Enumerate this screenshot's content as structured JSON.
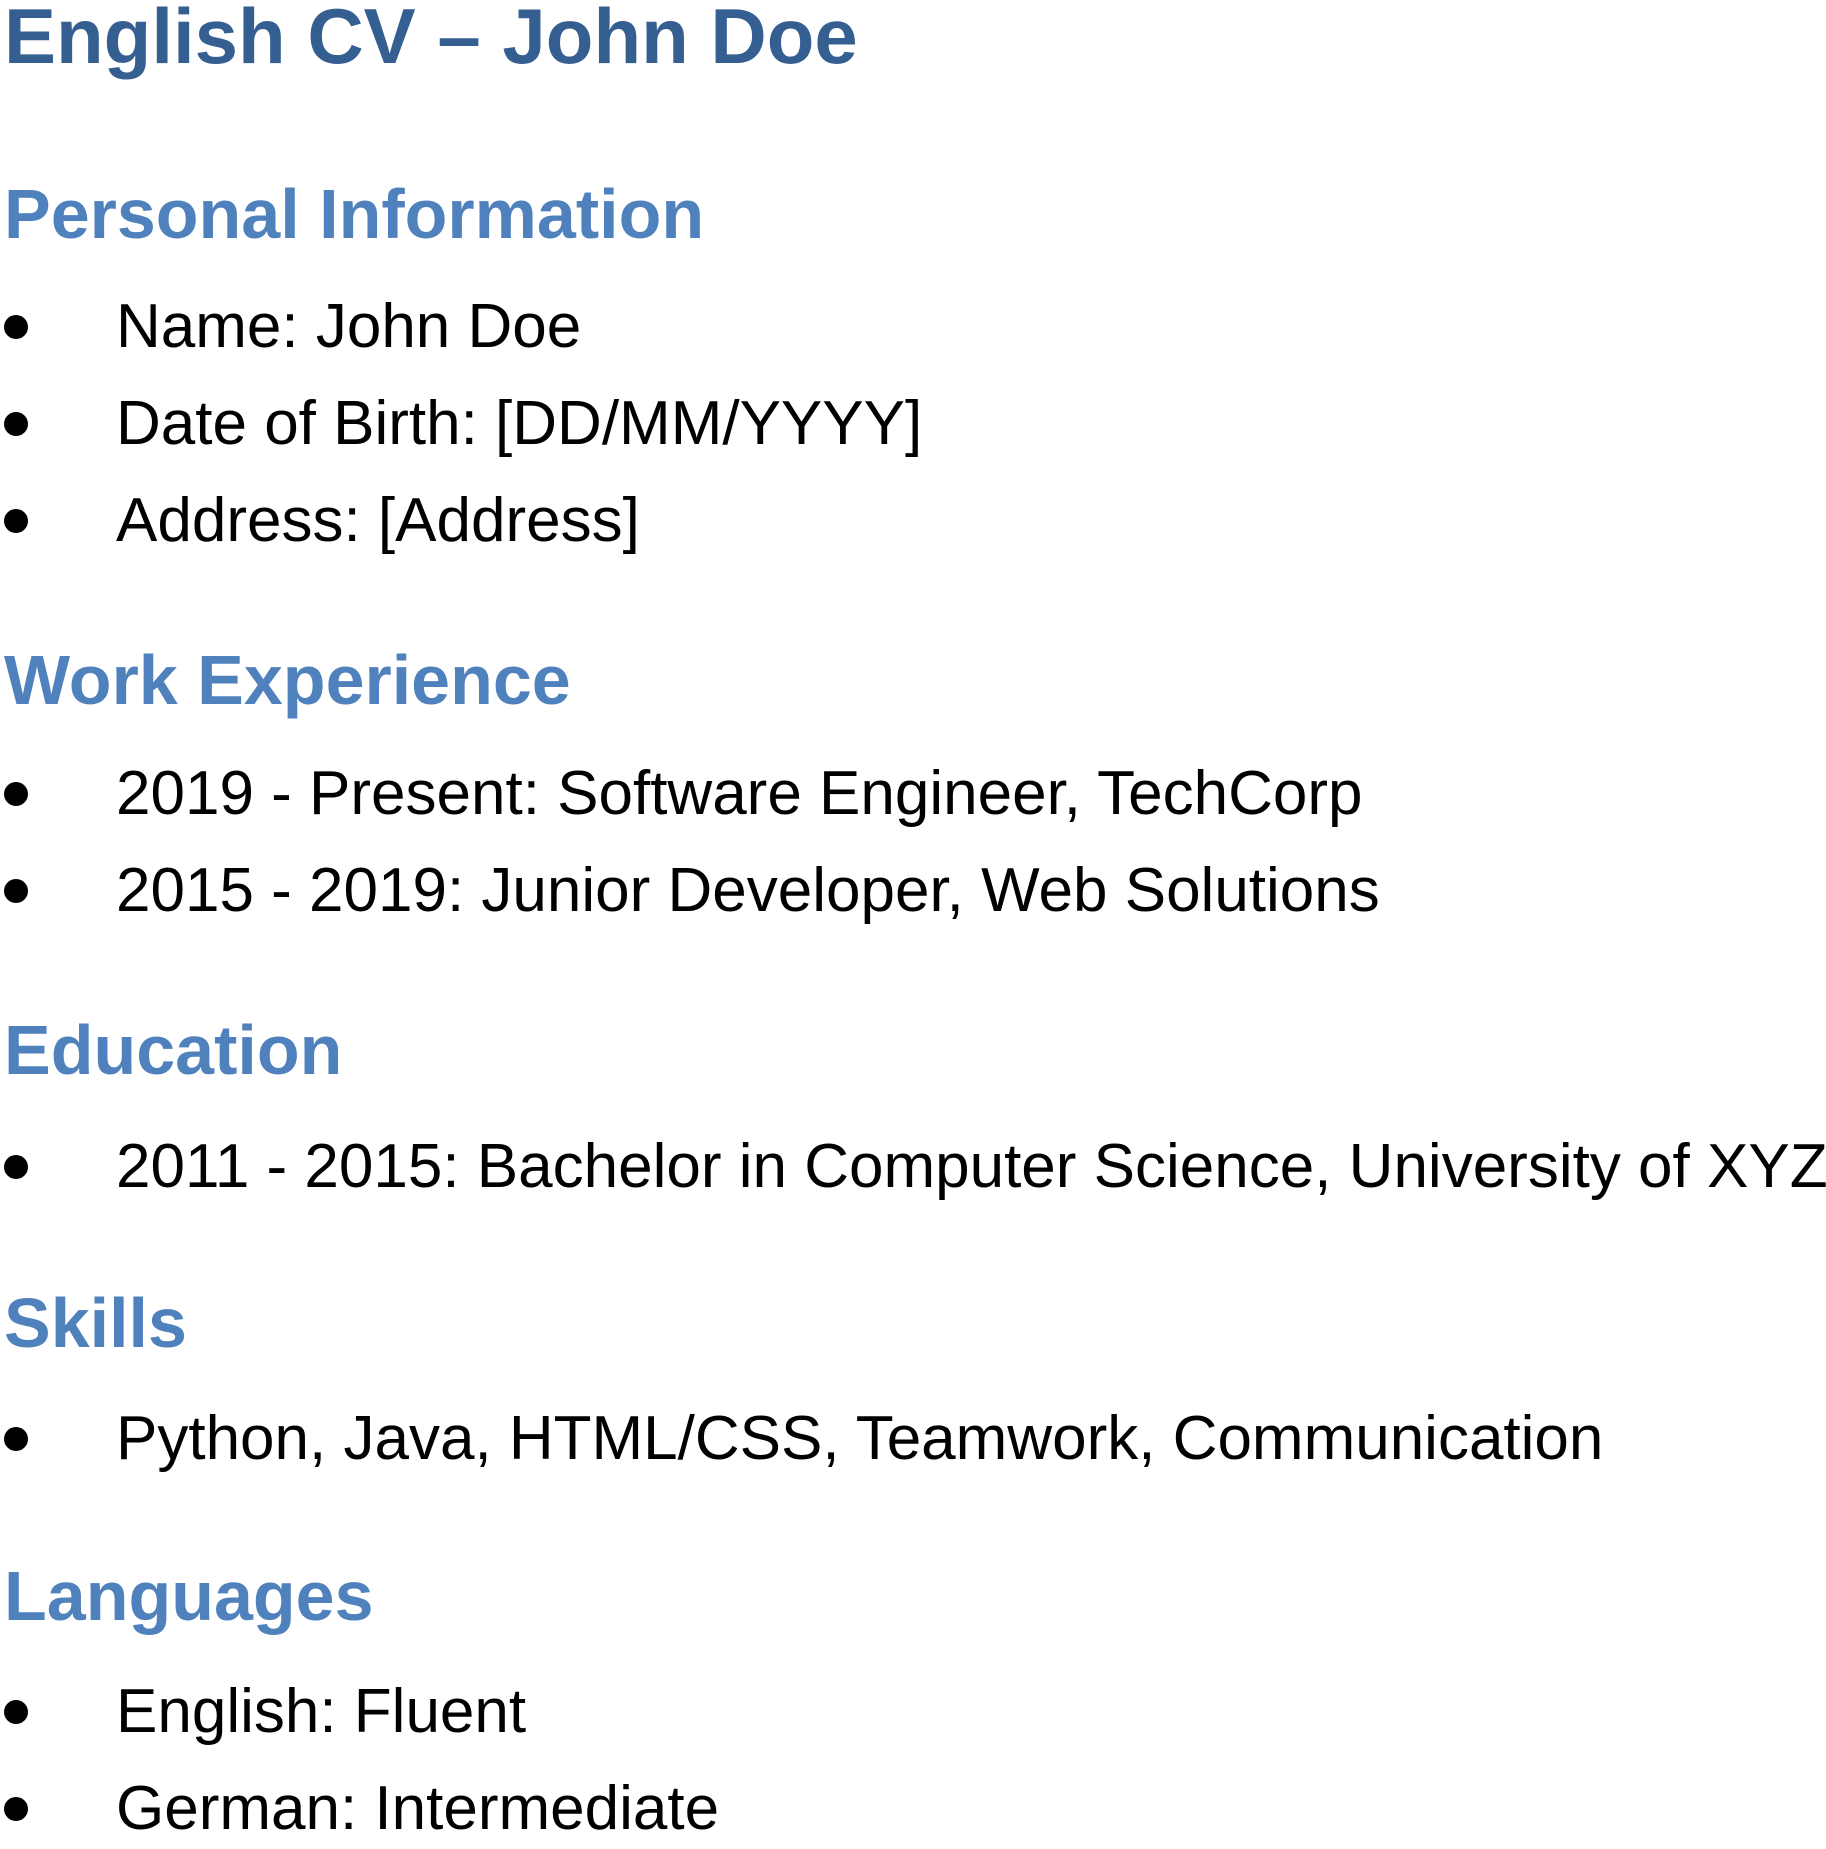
{
  "title": "English CV – John Doe",
  "sections": {
    "personal": {
      "heading": "Personal Information",
      "items": [
        "Name: John Doe",
        "Date of Birth: [DD/MM/YYYY]",
        "Address: [Address]"
      ]
    },
    "work": {
      "heading": "Work Experience",
      "items": [
        "2019 - Present: Software Engineer, TechCorp",
        "2015 - 2019: Junior Developer, Web Solutions"
      ]
    },
    "education": {
      "heading": "Education",
      "items": [
        "2011 - 2015: Bachelor in Computer Science, University of XYZ"
      ]
    },
    "skills": {
      "heading": "Skills",
      "items": [
        "Python, Java, HTML/CSS, Teamwork, Communication"
      ]
    },
    "languages": {
      "heading": "Languages",
      "items": [
        "English: Fluent",
        "German: Intermediate"
      ]
    }
  }
}
